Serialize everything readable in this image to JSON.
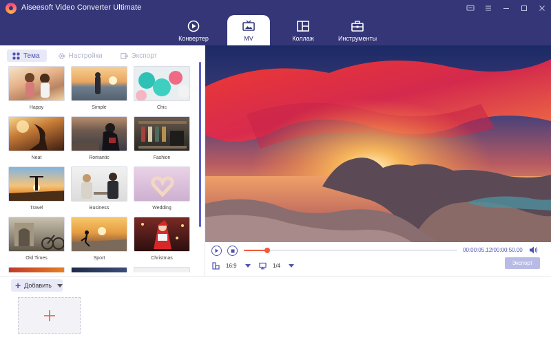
{
  "app": {
    "title": "Aiseesoft Video Converter Ultimate",
    "colors": {
      "header": "#343678",
      "accent": "#4f52b0",
      "progress": "#f05a3c"
    }
  },
  "window_controls": [
    "feedback-icon",
    "menu-icon",
    "minimize-icon",
    "maximize-icon",
    "close-icon"
  ],
  "top_tabs": [
    {
      "label": "Конвертер",
      "icon": "convert-icon",
      "active": false
    },
    {
      "label": "MV",
      "icon": "mv-icon",
      "active": true
    },
    {
      "label": "Коллаж",
      "icon": "collage-icon",
      "active": false
    },
    {
      "label": "Инструменты",
      "icon": "toolbox-icon",
      "active": false
    }
  ],
  "subtabs": [
    {
      "label": "Тема",
      "icon": "grid-icon",
      "active": true
    },
    {
      "label": "Настройки",
      "icon": "gear-icon",
      "active": false
    },
    {
      "label": "Экспорт",
      "icon": "export-icon",
      "active": false
    }
  ],
  "themes": [
    {
      "name": "Happy"
    },
    {
      "name": "Simple"
    },
    {
      "name": "Chic"
    },
    {
      "name": "Neat"
    },
    {
      "name": "Romantic"
    },
    {
      "name": "Fashion"
    },
    {
      "name": "Travel"
    },
    {
      "name": "Business"
    },
    {
      "name": "Wedding"
    },
    {
      "name": "Old Times"
    },
    {
      "name": "Sport"
    },
    {
      "name": "Christmas"
    }
  ],
  "player": {
    "time": "00:00:05.12/00:00:50.00",
    "progress_fraction": 0.11,
    "aspect_ratio": "16:9",
    "page": "1/4",
    "export_label": "Экспорт"
  },
  "bottom": {
    "add_label": "Добавить"
  }
}
